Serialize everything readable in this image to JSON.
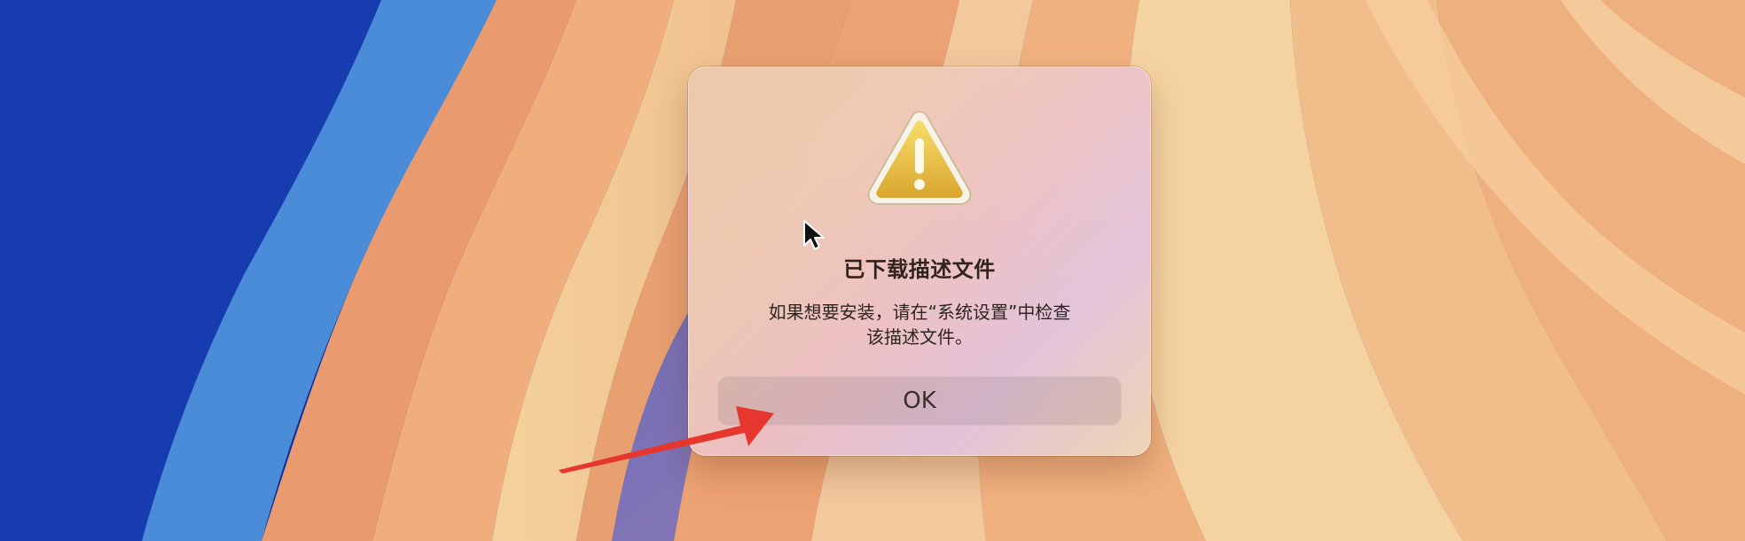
{
  "desktop": {
    "wallpaper": "macos-sequoia-wallpaper"
  },
  "dialog": {
    "icon": "warning-icon",
    "title": "已下载描述文件",
    "message_line_1": "如果想要安装，请在“系统设置”中检查",
    "message_line_2": "该描述文件。",
    "ok_label": "OK"
  },
  "overlay": {
    "cursor_icon": "mouse-pointer-icon",
    "arrow_icon": "annotation-arrow-icon",
    "arrow_color": "#e6372f"
  }
}
